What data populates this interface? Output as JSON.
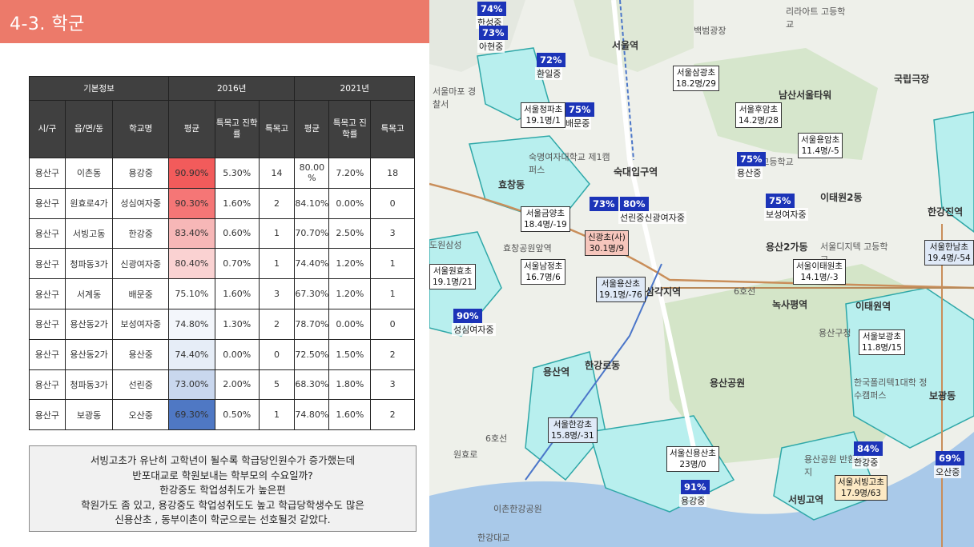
{
  "header": {
    "title": "4-3. 학군"
  },
  "table": {
    "group_headers": [
      "기본정보",
      "2016년",
      "2021년"
    ],
    "columns": [
      "시/구",
      "읍/면/동",
      "학교명",
      "평균",
      "특목고 진학률",
      "특목고",
      "평균",
      "특목고 진학률",
      "특목고"
    ],
    "rows": [
      [
        "용산구",
        "이촌동",
        "용강중",
        "90.90%",
        "5.30%",
        "14",
        "80.00 %",
        "7.20%",
        "18"
      ],
      [
        "용산구",
        "원효로4가",
        "성심여자중",
        "90.30%",
        "1.60%",
        "2",
        "84.10%",
        "0.00%",
        "0"
      ],
      [
        "용산구",
        "서빙고동",
        "한강중",
        "83.40%",
        "0.60%",
        "1",
        "70.70%",
        "2.50%",
        "3"
      ],
      [
        "용산구",
        "청파동3가",
        "신광여자중",
        "80.40%",
        "0.70%",
        "1",
        "74.40%",
        "1.20%",
        "1"
      ],
      [
        "용산구",
        "서계동",
        "배문중",
        "75.10%",
        "1.60%",
        "3",
        "67.30%",
        "1.20%",
        "1"
      ],
      [
        "용산구",
        "용산동2가",
        "보성여자중",
        "74.80%",
        "1.30%",
        "2",
        "78.70%",
        "0.00%",
        "0"
      ],
      [
        "용산구",
        "용산동2가",
        "용산중",
        "74.40%",
        "0.00%",
        "0",
        "72.50%",
        "1.50%",
        "2"
      ],
      [
        "용산구",
        "청파동3가",
        "선린중",
        "73.00%",
        "2.00%",
        "5",
        "68.30%",
        "1.80%",
        "3"
      ],
      [
        "용산구",
        "보광동",
        "오산중",
        "69.30%",
        "0.50%",
        "1",
        "74.80%",
        "1.60%",
        "2"
      ]
    ],
    "highlight_colors": [
      "#f25b5b",
      "#f57676",
      "#f7b7b7",
      "#fad2d2",
      "#ffffff",
      "#f3f6fb",
      "#e6edf7",
      "#c9d7ee",
      "#4f78c4"
    ]
  },
  "note": {
    "lines": [
      "서빙고초가 유난히 고학년이 될수록 학급당인원수가 증가했는데",
      "반포대교로 학원보내는 학부모의 수요일까?",
      "한강중도 학업성취도가 높은편",
      "학원가도 좀 있고, 용강중도 학업성취도도 높고 학급당학생수도 많은",
      "신용산초 , 동부이촌이 학군으로는 선호될것 같았다."
    ]
  },
  "map": {
    "elementary_labels": [
      {
        "name": "서울삼광초",
        "value": "18.2명/29",
        "style": "plain"
      },
      {
        "name": "서울청파초",
        "value": "19.1명/1",
        "style": "plain"
      },
      {
        "name": "서울후암초",
        "value": "14.2명/28",
        "style": "plain"
      },
      {
        "name": "서울용암초",
        "value": "11.4명/-5",
        "style": "plain"
      },
      {
        "name": "서울금양초",
        "value": "18.4명/-19",
        "style": "plain"
      },
      {
        "name": "신광초(사)",
        "value": "30.1명/9",
        "style": "pink"
      },
      {
        "name": "서울남정초",
        "value": "16.7명/6",
        "style": "plain"
      },
      {
        "name": "서울원효초",
        "value": "19.1명/21",
        "style": "plain"
      },
      {
        "name": "서울용산초",
        "value": "19.1명/-76",
        "style": "blue"
      },
      {
        "name": "서울이태원초",
        "value": "14.1명/-3",
        "style": "plain"
      },
      {
        "name": "서울한남초",
        "value": "19.4명/-54",
        "style": "blue"
      },
      {
        "name": "서울보광초",
        "value": "11.8명/15",
        "style": "plain"
      },
      {
        "name": "서울한강초",
        "value": "15.8명/-31",
        "style": "blue"
      },
      {
        "name": "서울신용산초",
        "value": "23명/0",
        "style": "plain"
      },
      {
        "name": "서울서빙고초",
        "value": "17.9명/63",
        "style": "yellow"
      }
    ],
    "middle_schools": [
      {
        "pct": "74%",
        "name": "한성중"
      },
      {
        "pct": "73%",
        "name": "아현중"
      },
      {
        "pct": "72%",
        "name": "환일중"
      },
      {
        "pct": "75%",
        "name": "배문중"
      },
      {
        "pct": "75%",
        "name": "용산중"
      },
      {
        "pct": "75%",
        "name": "보성여자중"
      },
      {
        "pct": "73%",
        "name": ""
      },
      {
        "pct": "80%",
        "name": "선린중신광여자중"
      },
      {
        "pct": "90%",
        "name": "성심여자중"
      },
      {
        "pct": "91%",
        "name": "용강중"
      },
      {
        "pct": "84%",
        "name": "한강중"
      },
      {
        "pct": "69%",
        "name": "오산중"
      }
    ],
    "places": [
      "서울역",
      "백범광장",
      "남산서울타워",
      "국립극장",
      "리라아트 고등학교",
      "숙명여자대학교 제1캠퍼스",
      "숙대입구역",
      "효창동",
      "효창공원앞역",
      "용산2가동",
      "이태원2동",
      "이태원역",
      "녹사평역",
      "한강진역",
      "용산역",
      "한강로동",
      "용산공원",
      "이촌한강공원",
      "한강대교",
      "서빙고역",
      "용산공원 반환부지",
      "한국폴리텍1대학 정수캠퍼스",
      "보광동",
      "삼각지역",
      "6호선",
      "용산구청",
      "서울디지텍 고등학교",
      "용산고등학교",
      "도원삼성",
      "서울마포 경찰서",
      "6호선",
      "원효로"
    ]
  }
}
